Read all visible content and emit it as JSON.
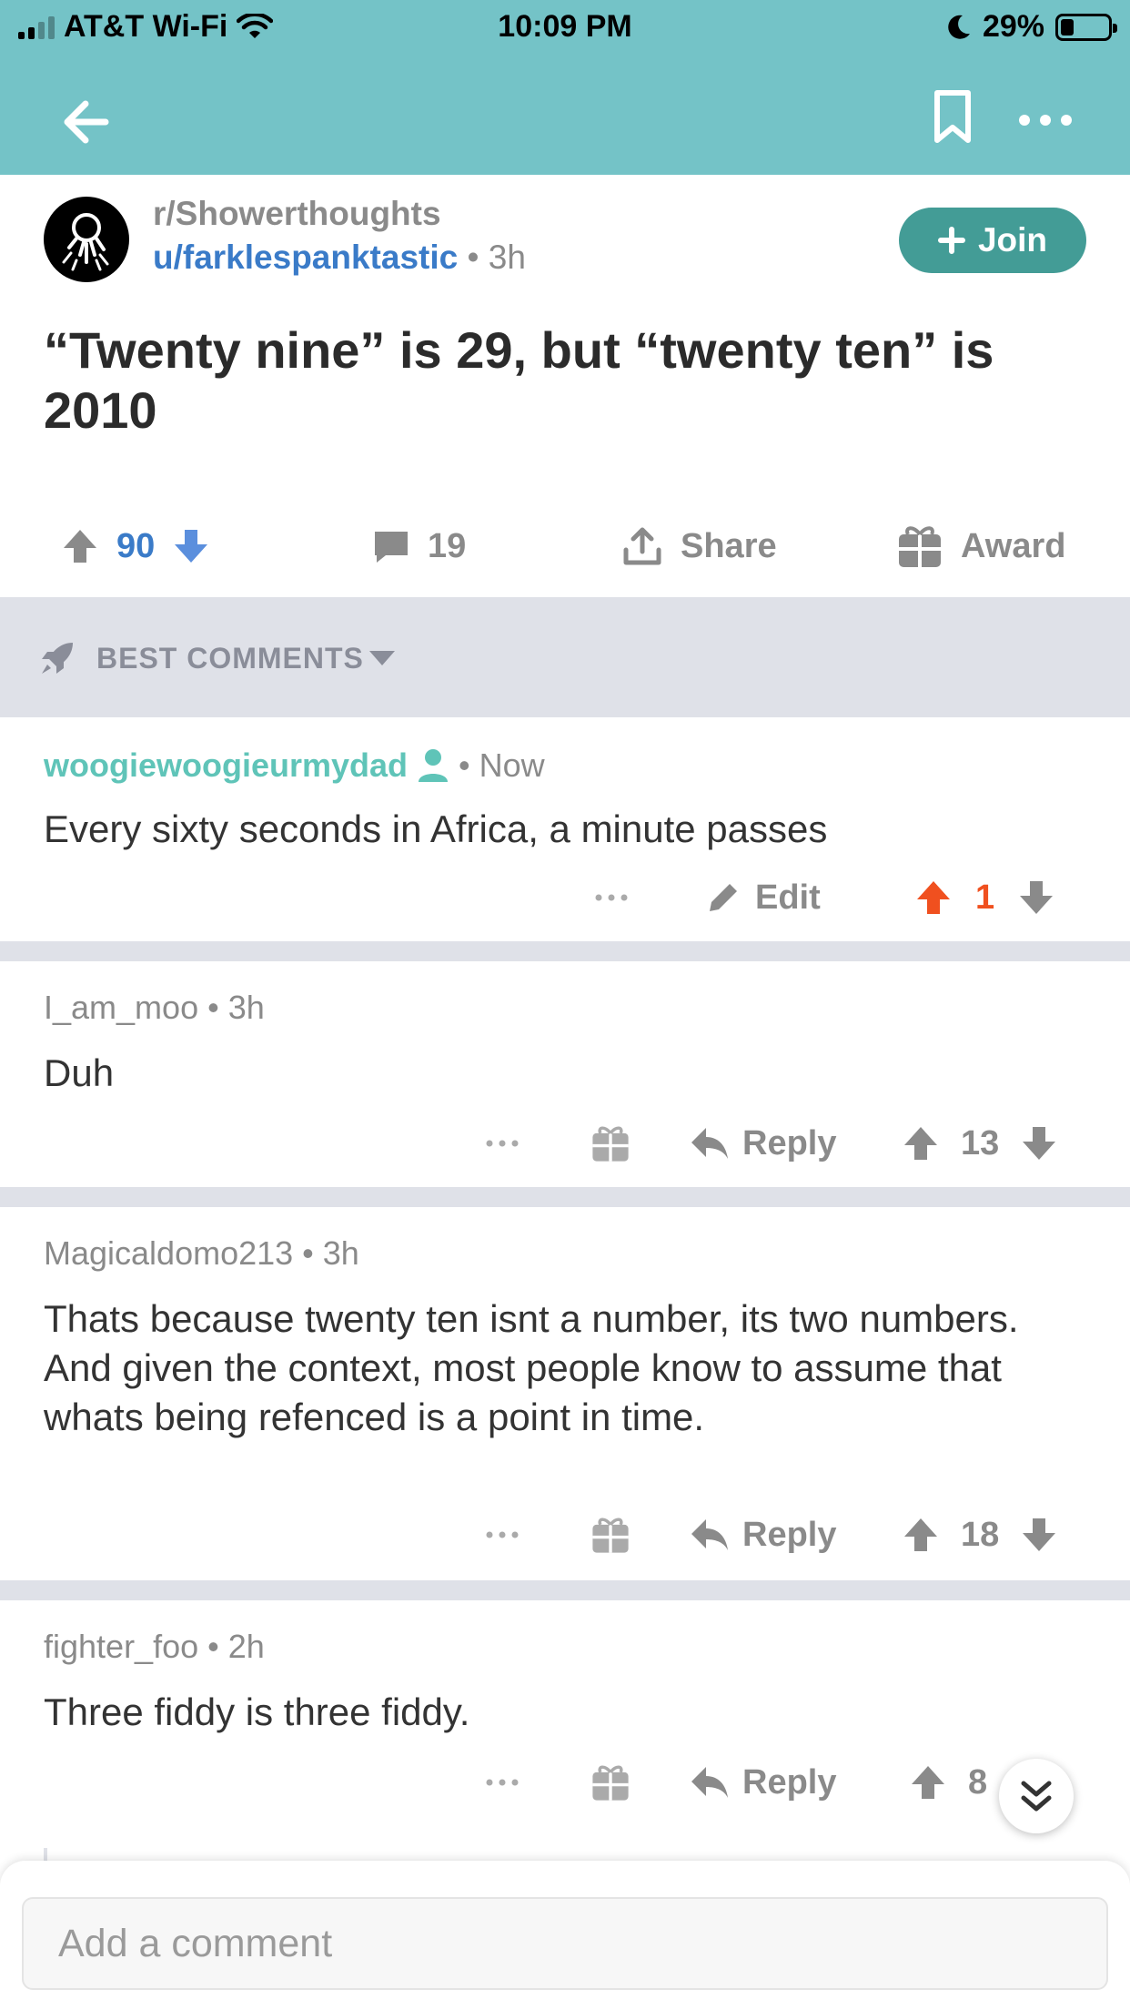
{
  "status_bar": {
    "carrier": "AT&T Wi-Fi",
    "time": "10:09 PM",
    "battery": "29%",
    "battery_level": 0.29
  },
  "nav": {
    "back_icon": "back-arrow-icon",
    "bookmark_icon": "bookmark-icon",
    "more_icon": "more-icon"
  },
  "post": {
    "subreddit": "r/Showerthoughts",
    "author": "u/farklespanktastic",
    "separator": "•",
    "age": "3h",
    "join_label": "Join",
    "title": "“Twenty nine” is 29, but “twenty ten” is 2010",
    "votes": "90",
    "comments": "19",
    "share_label": "Share",
    "award_label": "Award"
  },
  "sort": {
    "label": "BEST COMMENTS"
  },
  "comments": [
    {
      "author": "woogiewoogieurmydad",
      "age": "Now",
      "body": "Every sixty seconds in Africa, a minute passes",
      "edit_label": "Edit",
      "score": "1"
    },
    {
      "author": "I_am_moo",
      "age": "3h",
      "body": "Duh",
      "reply_label": "Reply",
      "score": "13"
    },
    {
      "author": "Magicaldomo213",
      "age": "3h",
      "body": "Thats because twenty ten isnt a number, its two numbers. And given the context, most people know to assume that whats being refenced is a point in time.",
      "reply_label": "Reply",
      "score": "18"
    },
    {
      "author": "fighter_foo",
      "age": "2h",
      "body": "Three fiddy is three fiddy.",
      "reply_label": "Reply",
      "score": "8"
    }
  ],
  "compose": {
    "placeholder": "Add a comment"
  },
  "colors": {
    "header": "#74c3c7",
    "join": "#439c96",
    "username_link": "#3a7bc8",
    "op_user": "#5fc4b8",
    "upvote_active": "#f0501f",
    "separator": "#dfe1e8"
  }
}
